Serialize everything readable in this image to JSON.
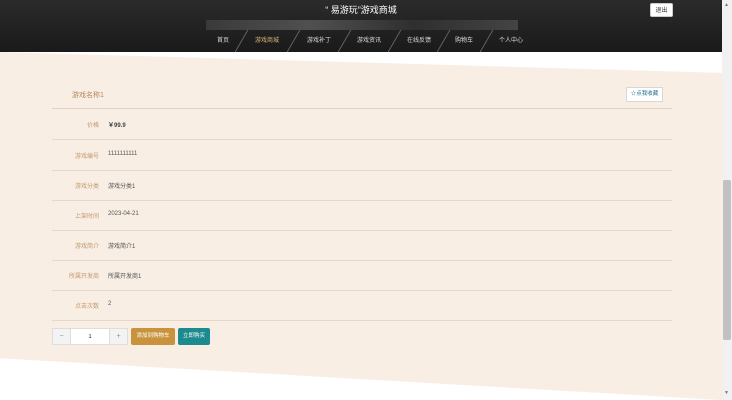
{
  "header": {
    "title": "“ 易游玩”游戏商城",
    "logout_label": "退出"
  },
  "nav": {
    "items": [
      {
        "label": "首页"
      },
      {
        "label": "游戏商城",
        "active": true
      },
      {
        "label": "游戏补丁"
      },
      {
        "label": "游戏资讯"
      },
      {
        "label": "在线反馈"
      },
      {
        "label": "购物车"
      },
      {
        "label": "个人中心"
      }
    ]
  },
  "game": {
    "name": "游戏名称1",
    "favorite_label": "☆点我收藏",
    "rows": [
      {
        "label": "价格",
        "value": "￥99.9"
      },
      {
        "label": "游戏编号",
        "value": "1111111111"
      },
      {
        "label": "游戏分类",
        "value": "游戏分类1"
      },
      {
        "label": "上架时间",
        "value": "2023-04-21"
      },
      {
        "label": "游戏简介",
        "value": "游戏简介1"
      },
      {
        "label": "所属开发商",
        "value": "所属开发商1"
      },
      {
        "label": "点击次数",
        "value": "2"
      }
    ]
  },
  "purchase": {
    "minus": "−",
    "plus": "+",
    "quantity": "1",
    "add_to_cart_label": "添加到购物车",
    "buy_now_label": "立即购买"
  },
  "colors": {
    "accent_gold": "#c9933e",
    "accent_teal": "#1c8a8f",
    "page_bg": "#f8eee3",
    "header_bg": "#1a1a1a"
  }
}
